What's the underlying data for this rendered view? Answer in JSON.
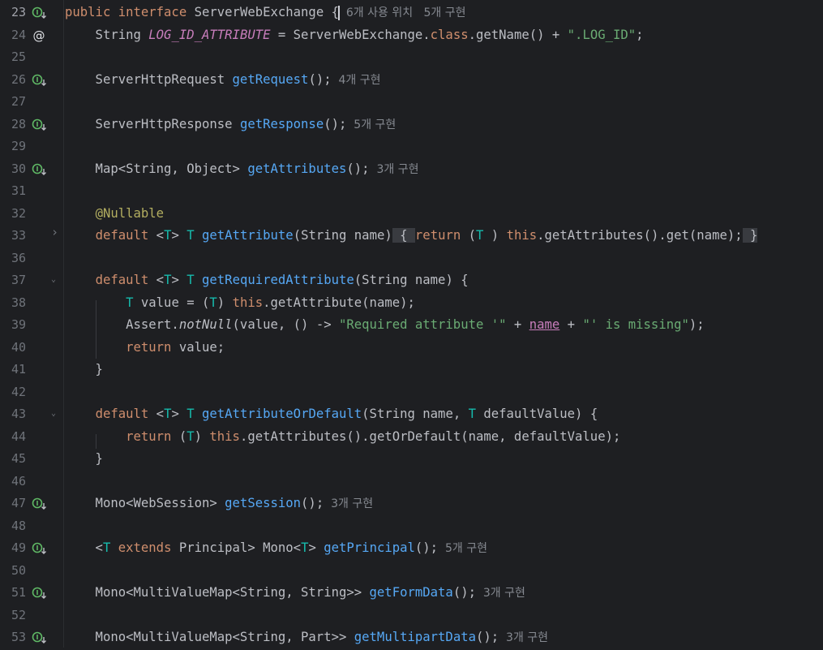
{
  "editor": {
    "colors": {
      "background": "#1e1f22",
      "keyword": "#cf8e6d",
      "method": "#56a8f5",
      "type_param": "#16baac",
      "string": "#6aab73",
      "annotation": "#b3ae60",
      "constant": "#c77dbb",
      "text": "#bcbec4",
      "hint": "#868a91",
      "implements_icon": "#5fb865"
    },
    "lines": [
      {
        "num": "23",
        "gutter_icon": "implemented-icon",
        "tokens": [
          [
            "kw",
            "public "
          ],
          [
            "kw",
            "interface "
          ],
          [
            "",
            "ServerWebExchange "
          ],
          [
            "",
            "{"
          ],
          [
            "caret",
            ""
          ],
          [
            "hint",
            "  6개 사용 위치   5개 구현"
          ]
        ]
      },
      {
        "num": "24",
        "gutter_icon": "at-annotation-icon",
        "tokens": [
          [
            "",
            "    String "
          ],
          [
            "cf",
            "LOG_ID_ATTRIBUTE"
          ],
          [
            "",
            " = ServerWebExchange."
          ],
          [
            "kw",
            "class"
          ],
          [
            "",
            ".getName() + "
          ],
          [
            "st",
            "\".LOG_ID\""
          ],
          [
            "",
            ";"
          ]
        ]
      },
      {
        "num": "25",
        "tokens": []
      },
      {
        "num": "26",
        "gutter_icon": "implemented-icon",
        "tokens": [
          [
            "",
            "    ServerHttpRequest "
          ],
          [
            "fn",
            "getRequest"
          ],
          [
            "",
            "();"
          ],
          [
            "hint",
            "  4개 구현"
          ]
        ]
      },
      {
        "num": "27",
        "tokens": []
      },
      {
        "num": "28",
        "gutter_icon": "implemented-icon",
        "tokens": [
          [
            "",
            "    ServerHttpResponse "
          ],
          [
            "fn",
            "getResponse"
          ],
          [
            "",
            "();"
          ],
          [
            "hint",
            "  5개 구현"
          ]
        ]
      },
      {
        "num": "29",
        "tokens": []
      },
      {
        "num": "30",
        "gutter_icon": "implemented-icon",
        "tokens": [
          [
            "",
            "    Map<String, Object> "
          ],
          [
            "fn",
            "getAttributes"
          ],
          [
            "",
            "();"
          ],
          [
            "hint",
            "  3개 구현"
          ]
        ]
      },
      {
        "num": "31",
        "tokens": []
      },
      {
        "num": "32",
        "tokens": [
          [
            "",
            "    "
          ],
          [
            "an",
            "@Nullable"
          ]
        ]
      },
      {
        "num": "33",
        "fold": "collapsed",
        "tokens": [
          [
            "",
            "    "
          ],
          [
            "kw",
            "default "
          ],
          [
            "",
            "<"
          ],
          [
            "tp",
            "T"
          ],
          [
            "",
            "> "
          ],
          [
            "tp",
            "T "
          ],
          [
            "fn",
            "getAttribute"
          ],
          [
            "",
            "(String name)"
          ],
          [
            "fbox",
            " { "
          ],
          [
            "kw",
            "return "
          ],
          [
            "",
            "("
          ],
          [
            "tp",
            "T"
          ],
          [
            "",
            " ) "
          ],
          [
            "kw",
            "this"
          ],
          [
            "",
            ".getAttributes().get(name);"
          ],
          [
            "fbox",
            " }"
          ]
        ]
      },
      {
        "num": "36",
        "tokens": []
      },
      {
        "num": "37",
        "fold": "expanded",
        "tokens": [
          [
            "",
            "    "
          ],
          [
            "kw",
            "default "
          ],
          [
            "",
            "<"
          ],
          [
            "tp",
            "T"
          ],
          [
            "",
            "> "
          ],
          [
            "tp",
            "T "
          ],
          [
            "fn",
            "getRequiredAttribute"
          ],
          [
            "",
            "(String name) {"
          ]
        ]
      },
      {
        "num": "38",
        "tokens": [
          [
            "",
            "        "
          ],
          [
            "tp",
            "T "
          ],
          [
            "",
            "value = ("
          ],
          [
            "tp",
            "T"
          ],
          [
            "",
            ") "
          ],
          [
            "kw",
            "this"
          ],
          [
            "",
            ".getAttribute(name);"
          ]
        ]
      },
      {
        "num": "39",
        "tokens": [
          [
            "",
            "        Assert."
          ],
          [
            "it",
            "notNull"
          ],
          [
            "",
            "(value, () -> "
          ],
          [
            "st",
            "\"Required attribute '\""
          ],
          [
            "",
            " + "
          ],
          [
            "pm",
            "name"
          ],
          [
            "",
            " + "
          ],
          [
            "st",
            "\"' is missing\""
          ],
          [
            "",
            ");"
          ]
        ]
      },
      {
        "num": "40",
        "tokens": [
          [
            "",
            "        "
          ],
          [
            "kw",
            "return "
          ],
          [
            "",
            "value;"
          ]
        ]
      },
      {
        "num": "41",
        "tokens": [
          [
            "",
            "    }"
          ]
        ]
      },
      {
        "num": "42",
        "tokens": []
      },
      {
        "num": "43",
        "fold": "expanded",
        "tokens": [
          [
            "",
            "    "
          ],
          [
            "kw",
            "default "
          ],
          [
            "",
            "<"
          ],
          [
            "tp",
            "T"
          ],
          [
            "",
            "> "
          ],
          [
            "tp",
            "T "
          ],
          [
            "fn",
            "getAttributeOrDefault"
          ],
          [
            "",
            "(String name, "
          ],
          [
            "tp",
            "T "
          ],
          [
            "",
            "defaultValue) {"
          ]
        ]
      },
      {
        "num": "44",
        "tokens": [
          [
            "",
            "        "
          ],
          [
            "kw",
            "return "
          ],
          [
            "",
            "("
          ],
          [
            "tp",
            "T"
          ],
          [
            "",
            ") "
          ],
          [
            "kw",
            "this"
          ],
          [
            "",
            ".getAttributes().getOrDefault(name, defaultValue);"
          ]
        ]
      },
      {
        "num": "45",
        "tokens": [
          [
            "",
            "    }"
          ]
        ]
      },
      {
        "num": "46",
        "tokens": []
      },
      {
        "num": "47",
        "gutter_icon": "implemented-icon",
        "tokens": [
          [
            "",
            "    Mono<WebSession> "
          ],
          [
            "fn",
            "getSession"
          ],
          [
            "",
            "();"
          ],
          [
            "hint",
            "  3개 구현"
          ]
        ]
      },
      {
        "num": "48",
        "tokens": []
      },
      {
        "num": "49",
        "gutter_icon": "implemented-icon",
        "tokens": [
          [
            "",
            "    <"
          ],
          [
            "tp",
            "T "
          ],
          [
            "kw",
            "extends "
          ],
          [
            "",
            "Principal> Mono<"
          ],
          [
            "tp",
            "T"
          ],
          [
            "",
            "> "
          ],
          [
            "fn",
            "getPrincipal"
          ],
          [
            "",
            "();"
          ],
          [
            "hint",
            "  5개 구현"
          ]
        ]
      },
      {
        "num": "50",
        "tokens": []
      },
      {
        "num": "51",
        "gutter_icon": "implemented-icon",
        "tokens": [
          [
            "",
            "    Mono<MultiValueMap<String, String>> "
          ],
          [
            "fn",
            "getFormData"
          ],
          [
            "",
            "();"
          ],
          [
            "hint",
            "  3개 구현"
          ]
        ]
      },
      {
        "num": "52",
        "tokens": []
      },
      {
        "num": "53",
        "gutter_icon": "implemented-icon",
        "tokens": [
          [
            "",
            "    Mono<MultiValueMap<String, Part>> "
          ],
          [
            "fn",
            "getMultipartData"
          ],
          [
            "",
            "();"
          ],
          [
            "hint",
            "  3개 구현"
          ]
        ]
      }
    ]
  }
}
